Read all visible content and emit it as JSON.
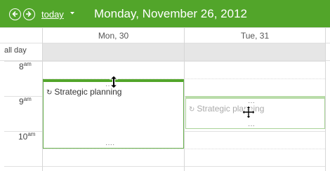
{
  "header": {
    "prev_icon": "chevron-left-icon",
    "next_icon": "chevron-right-icon",
    "today_label": "today",
    "dropdown_icon": "caret-down-icon",
    "date_title": "Monday, November 26, 2012"
  },
  "columns": [
    {
      "label": "Mon, 30"
    },
    {
      "label": "Tue, 31"
    }
  ],
  "all_day_label": "all day",
  "hours": [
    {
      "num": "8",
      "suffix": "am"
    },
    {
      "num": "9",
      "suffix": "am"
    },
    {
      "num": "10",
      "suffix": "am"
    }
  ],
  "events": {
    "main": {
      "title": "Strategic planning",
      "icon": "repeat-icon"
    },
    "ghost": {
      "title": "Strategic planning",
      "icon": "repeat-icon"
    }
  },
  "cursors": {
    "resize": "resize-vertical-cursor-icon",
    "move": "move-cursor-icon"
  },
  "colors": {
    "header_bg": "#52a52a",
    "event_border": "#69b04e",
    "ghost_border": "#a9d397",
    "allday_bg": "#e6e6e6"
  }
}
